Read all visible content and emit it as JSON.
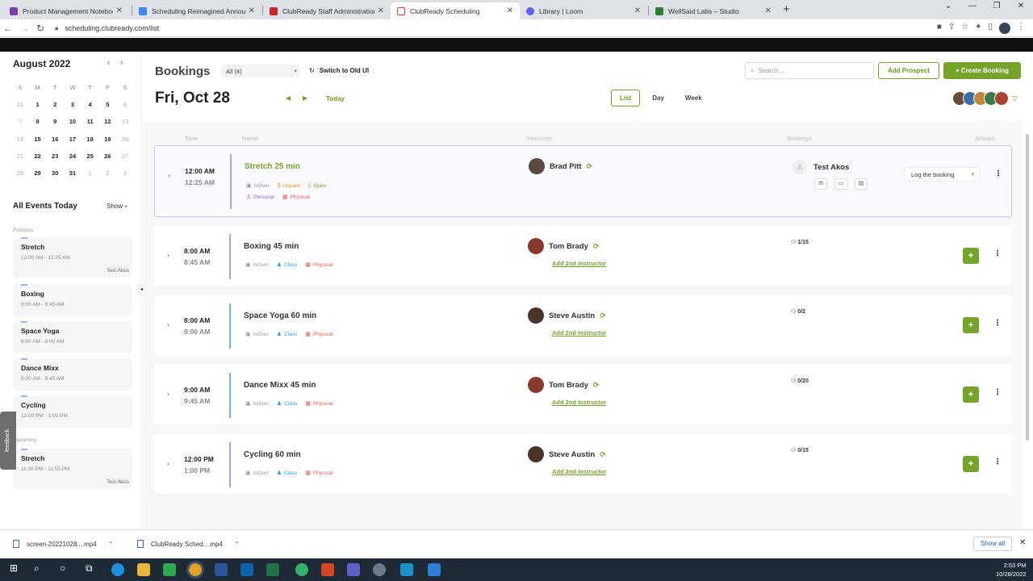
{
  "browser": {
    "tabs": [
      {
        "label": "Product Management Notebook",
        "fav_color": "#7a3ea8"
      },
      {
        "label": "Scheduling Reimagined Announc...",
        "fav_color": "#4285f4"
      },
      {
        "label": "ClubReady Staff Administration",
        "fav_color": "#c62828"
      },
      {
        "label": "ClubReady Scheduling",
        "fav_color": "#e53935"
      },
      {
        "label": "Library | Loom",
        "fav_color": "#625df5"
      },
      {
        "label": "WellSaid Labs – Studio",
        "fav_color": "#2e7d32"
      }
    ],
    "url": "scheduling.clubready.com/list"
  },
  "calendar": {
    "month_title": "August 2022",
    "dow": [
      "S",
      "M",
      "T",
      "W",
      "T",
      "F",
      "S"
    ],
    "days": [
      {
        "d": "31",
        "m": true
      },
      {
        "d": "1"
      },
      {
        "d": "2"
      },
      {
        "d": "3"
      },
      {
        "d": "4"
      },
      {
        "d": "5"
      },
      {
        "d": "6",
        "m": true
      },
      {
        "d": "7",
        "m": true
      },
      {
        "d": "8"
      },
      {
        "d": "9"
      },
      {
        "d": "10"
      },
      {
        "d": "11"
      },
      {
        "d": "12"
      },
      {
        "d": "13",
        "m": true
      },
      {
        "d": "14",
        "m": true
      },
      {
        "d": "15"
      },
      {
        "d": "16"
      },
      {
        "d": "17"
      },
      {
        "d": "18"
      },
      {
        "d": "19"
      },
      {
        "d": "20",
        "m": true
      },
      {
        "d": "21",
        "m": true
      },
      {
        "d": "22"
      },
      {
        "d": "23"
      },
      {
        "d": "24"
      },
      {
        "d": "25"
      },
      {
        "d": "26"
      },
      {
        "d": "27",
        "m": true
      },
      {
        "d": "28",
        "m": true
      },
      {
        "d": "29"
      },
      {
        "d": "30"
      },
      {
        "d": "31"
      },
      {
        "d": "1",
        "m": true
      },
      {
        "d": "2",
        "m": true
      },
      {
        "d": "3",
        "m": true
      }
    ]
  },
  "sidebar": {
    "all_events": "All Events Today",
    "show": "Show",
    "previous_label": "Previous",
    "upcoming_label": "Upcoming",
    "feedback": "feedback",
    "events": [
      {
        "name": "Stretch",
        "time": "12:00 AM - 12:25 AM",
        "person": "Test Akos"
      },
      {
        "name": "Boxing",
        "time": "8:00 AM - 8:45 AM",
        "person": ""
      },
      {
        "name": "Space Yoga",
        "time": "8:00 AM - 9:00 AM",
        "person": ""
      },
      {
        "name": "Dance Mixx",
        "time": "9:00 AM - 9:45 AM",
        "person": ""
      },
      {
        "name": "Cycling",
        "time": "12:00 PM - 1:00 PM",
        "person": ""
      },
      {
        "name": "Stretch",
        "time": "11:30 PM - 11:55 PM",
        "person": "Test Akos"
      }
    ]
  },
  "header": {
    "title": "Bookings",
    "filter": "All (4)",
    "switch_ui": "Switch to Old UI",
    "search_placeholder": "Search...",
    "add_prospect": "Add Prospect",
    "create_booking": "+ Create Booking",
    "date": "Fri, Oct 28",
    "today": "Today",
    "views": [
      "List",
      "Day",
      "Week"
    ],
    "active_view": "List"
  },
  "columns": {
    "time": "Time",
    "name": "Name",
    "instructor": "Instructor",
    "bookings": "Bookings",
    "actions": "Actions"
  },
  "bookings": [
    {
      "start": "12:00 AM",
      "end": "12:25 AM",
      "name": "Stretch 25 min",
      "bar_color": "#b39ddb",
      "tags": [
        {
          "label": "IsOver",
          "color": "#999",
          "icon": "▣"
        },
        {
          "label": "Unpaid",
          "color": "#e69a1c",
          "icon": "$"
        },
        {
          "label": "Open",
          "color": "#76a32a",
          "icon": "▯"
        },
        {
          "label": "Personal",
          "color": "#a55ec7",
          "icon": "♙"
        },
        {
          "label": "Physical",
          "color": "#e25c5c",
          "icon": "▦"
        }
      ],
      "instructor": "Brad Pitt",
      "client": "Test Akos",
      "log_label": "Log the booking"
    },
    {
      "start": "8:00 AM",
      "end": "8:45 AM",
      "name": "Boxing 45 min",
      "bar_color": "#b39ddb",
      "tags": [
        {
          "label": "IsOver",
          "color": "#999",
          "icon": "▣"
        },
        {
          "label": "Class",
          "color": "#2b9fd9",
          "icon": "♟"
        },
        {
          "label": "Physical",
          "color": "#e25c5c",
          "icon": "▦"
        }
      ],
      "instructor": "Tom Brady",
      "add2": "Add 2nd Instructor",
      "count": "1/15"
    },
    {
      "start": "8:00 AM",
      "end": "9:00 AM",
      "name": "Space Yoga 60 min",
      "bar_color": "#6fb3f0",
      "tags": [
        {
          "label": "IsOver",
          "color": "#999",
          "icon": "▣"
        },
        {
          "label": "Class",
          "color": "#2b9fd9",
          "icon": "♟"
        },
        {
          "label": "Physical",
          "color": "#e25c5c",
          "icon": "▦"
        }
      ],
      "instructor": "Steve Austin",
      "add2": "Add 2nd Instructor",
      "count": "0/2"
    },
    {
      "start": "9:00 AM",
      "end": "9:45 AM",
      "name": "Dance Mixx 45 min",
      "bar_color": "#6fb3f0",
      "tags": [
        {
          "label": "IsOver",
          "color": "#999",
          "icon": "▣"
        },
        {
          "label": "Class",
          "color": "#2b9fd9",
          "icon": "♟"
        },
        {
          "label": "Physical",
          "color": "#e25c5c",
          "icon": "▦"
        }
      ],
      "instructor": "Tom Brady",
      "add2": "Add 2nd Instructor",
      "count": "0/20"
    },
    {
      "start": "12:00 PM",
      "end": "1:00 PM",
      "name": "Cycling 60 min",
      "bar_color": "#b39ddb",
      "tags": [
        {
          "label": "IsOver",
          "color": "#999",
          "icon": "▣"
        },
        {
          "label": "Class",
          "color": "#2b9fd9",
          "icon": "♟"
        },
        {
          "label": "Physical",
          "color": "#e25c5c",
          "icon": "▦"
        }
      ],
      "instructor": "Steve Austin",
      "add2": "Add 2nd Instructor",
      "count": "0/15"
    }
  ],
  "downloads": {
    "items": [
      "screen-20221028....mp4",
      "ClubReady Sched....mp4"
    ],
    "show_all": "Show all"
  },
  "taskbar": {
    "time": "2:53 PM",
    "date": "10/28/2022"
  },
  "colors": {
    "accent": "#76a32a",
    "selected_border": "#c9c7ef"
  }
}
